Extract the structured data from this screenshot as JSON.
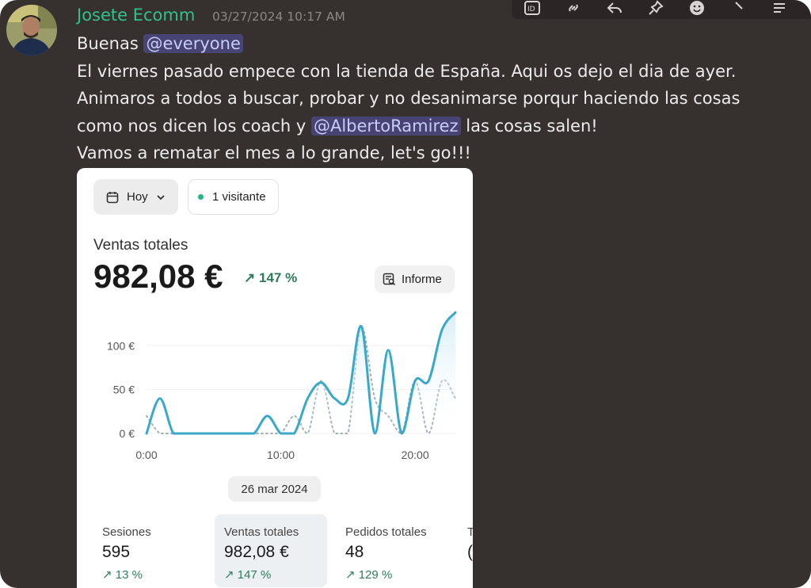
{
  "message": {
    "author": "Josete Ecomm",
    "timestamp": "03/27/2024 10:17 AM",
    "author_color": "#2fc28b",
    "line1_prefix": "Buenas",
    "line1_mention": "@everyone",
    "line2": "El viernes pasado empece con la tienda de España. Aqui os dejo el dia de ayer.",
    "line3": "Animaros a todos a buscar, probar y no desanimarse porqur haciendo las cosas",
    "line4_prefix": "como nos dicen los coach y",
    "line4_mention": "@AlbertoRamirez",
    "line4_suffix": "las cosas salen!",
    "line5": "Vamos a rematar el mes a lo grande, let's go!!!"
  },
  "toolbar": {
    "icons": [
      "id-icon",
      "link-icon",
      "reply-icon",
      "pin-icon",
      "emoji-icon",
      "more-icon",
      "thread-icon"
    ]
  },
  "card": {
    "date_filter": "Hoy",
    "visitors": "1 visitante",
    "sales_label": "Ventas totales",
    "sales_value": "982,08 €",
    "sales_delta": "147 %",
    "report_button": "Informe",
    "date_caption": "26 mar 2024",
    "metrics": [
      {
        "label": "Sesiones",
        "value": "595",
        "delta": "13 %"
      },
      {
        "label": "Ventas totales",
        "value": "982,08 €",
        "delta": "147 %"
      },
      {
        "label": "Pedidos totales",
        "value": "48",
        "delta": "129 %"
      },
      {
        "label": "T",
        "value": "(",
        "delta": ""
      }
    ]
  },
  "chart_data": {
    "type": "line",
    "x_ticks": [
      "0:00",
      "10:00",
      "20:00"
    ],
    "y_ticks": [
      "0 €",
      "50 €",
      "100 €"
    ],
    "ylim": [
      0,
      140
    ],
    "x": [
      0,
      1,
      2,
      3,
      4,
      5,
      6,
      7,
      8,
      9,
      10,
      11,
      12,
      13,
      14,
      15,
      16,
      17,
      18,
      19,
      20,
      21,
      22,
      23
    ],
    "series": [
      {
        "style": "solid",
        "color": "#3aa9c9",
        "values": [
          0,
          40,
          0,
          0,
          0,
          0,
          0,
          0,
          0,
          20,
          0,
          0,
          40,
          58,
          40,
          40,
          122,
          0,
          95,
          0,
          60,
          60,
          118,
          138
        ]
      },
      {
        "style": "dotted",
        "color": "#9fb0b8",
        "values": [
          20,
          0,
          0,
          0,
          0,
          0,
          0,
          0,
          0,
          0,
          0,
          20,
          0,
          60,
          0,
          0,
          120,
          40,
          20,
          0,
          60,
          0,
          60,
          40
        ]
      }
    ]
  }
}
